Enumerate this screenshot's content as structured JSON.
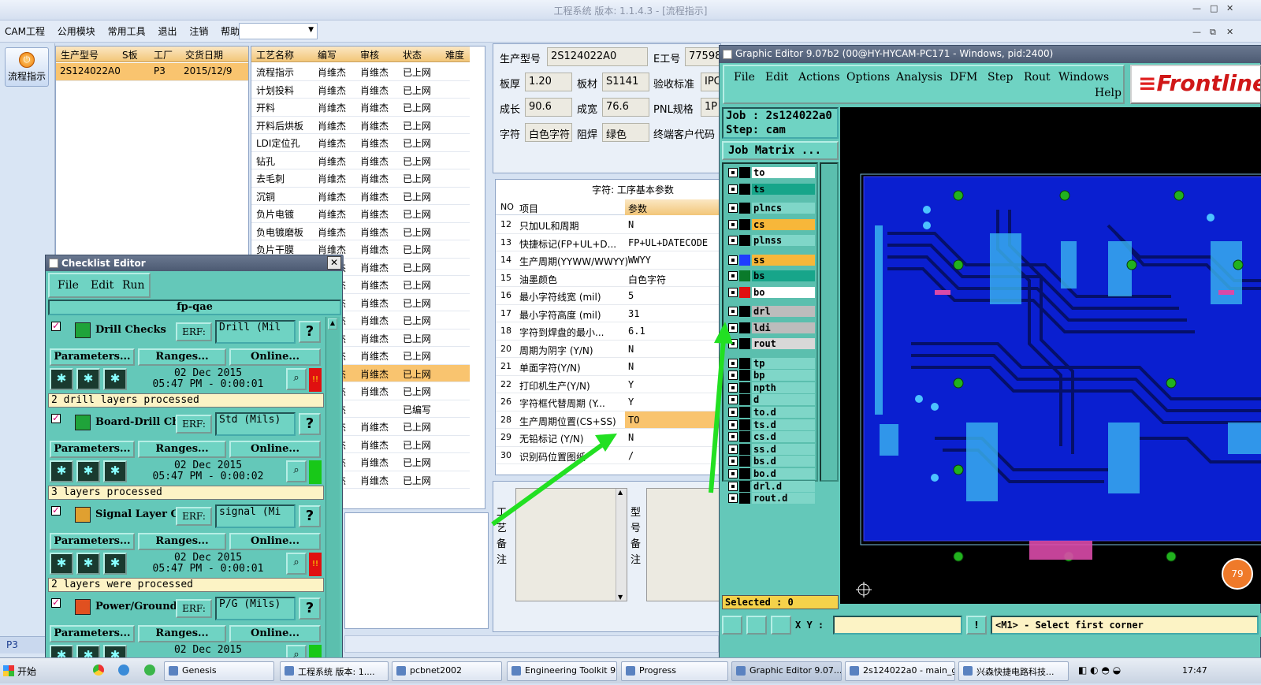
{
  "app": {
    "title": "工程系统  版本: 1.1.4.3 - [流程指示]",
    "menus": [
      "CAM工程",
      "公用模块",
      "常用工具",
      "退出",
      "注销",
      "帮助"
    ],
    "nav_button": "流程指示",
    "nav_bottom": "P3"
  },
  "order_grid": {
    "headers": [
      "生产型号",
      "S板",
      "工厂",
      "交货日期"
    ],
    "rows": [
      [
        "2S124022A0",
        "",
        "P3",
        "2015/12/9"
      ]
    ]
  },
  "process_grid": {
    "headers": [
      "工艺名称",
      "编写",
      "审核",
      "状态",
      "难度"
    ],
    "rows": [
      [
        "流程指示",
        "肖维杰",
        "肖维杰",
        "已上网",
        ""
      ],
      [
        "计划投料",
        "肖维杰",
        "肖维杰",
        "已上网",
        ""
      ],
      [
        "开料",
        "肖维杰",
        "肖维杰",
        "已上网",
        ""
      ],
      [
        "开料后烘板",
        "肖维杰",
        "肖维杰",
        "已上网",
        ""
      ],
      [
        "LDI定位孔",
        "肖维杰",
        "肖维杰",
        "已上网",
        ""
      ],
      [
        "钻孔",
        "肖维杰",
        "肖维杰",
        "已上网",
        ""
      ],
      [
        "去毛刺",
        "肖维杰",
        "肖维杰",
        "已上网",
        ""
      ],
      [
        "沉铜",
        "肖维杰",
        "肖维杰",
        "已上网",
        ""
      ],
      [
        "负片电镀",
        "肖维杰",
        "肖维杰",
        "已上网",
        ""
      ],
      [
        "负电镀磨板",
        "肖维杰",
        "肖维杰",
        "已上网",
        ""
      ],
      [
        "负片干膜",
        "肖维杰",
        "肖维杰",
        "已上网",
        ""
      ],
      [
        "",
        "肖维杰",
        "肖维杰",
        "已上网",
        ""
      ],
      [
        "",
        "肖维杰",
        "肖维杰",
        "已上网",
        ""
      ],
      [
        "",
        "肖维杰",
        "肖维杰",
        "已上网",
        ""
      ],
      [
        "",
        "肖维杰",
        "肖维杰",
        "已上网",
        ""
      ],
      [
        "",
        "肖维杰",
        "肖维杰",
        "已上网",
        ""
      ],
      [
        "",
        "肖维杰",
        "肖维杰",
        "已上网",
        ""
      ],
      [
        "",
        "肖维杰",
        "肖维杰",
        "已上网",
        ""
      ],
      [
        "",
        "肖维杰",
        "肖维杰",
        "已上网",
        ""
      ],
      [
        "",
        "肖维杰",
        "",
        "已编写",
        ""
      ],
      [
        "",
        "肖维杰",
        "肖维杰",
        "已上网",
        ""
      ],
      [
        "",
        "肖维杰",
        "肖维杰",
        "已上网",
        ""
      ],
      [
        "",
        "肖维杰",
        "肖维杰",
        "已上网",
        ""
      ],
      [
        "",
        "肖维杰",
        "肖维杰",
        "已上网",
        ""
      ]
    ]
  },
  "params_top": {
    "model_label": "生产型号",
    "model": "2S124022A0",
    "e_label": "E工号",
    "e_val": "77598",
    "thick_label": "板厚",
    "thick": "1.20",
    "mat_label": "板材",
    "mat": "S1141",
    "std_label": "验收标准",
    "std": "IPC",
    "len_label": "成长",
    "len": "90.6",
    "wid_label": "成宽",
    "wid": "76.6",
    "pnl_label": "PNL规格",
    "pnl": "1P",
    "char_label": "字符",
    "char": "白色字符",
    "mask_label": "阻焊",
    "mask": "绿色",
    "cust_label": "终端客户代码"
  },
  "param_grid": {
    "title": "字符: 工序基本参数",
    "headers": [
      "NO",
      "项目",
      "参数"
    ],
    "rows": [
      [
        "12",
        "只加UL和周期",
        "N"
      ],
      [
        "13",
        "快捷标记(FP+UL+D...",
        "FP+UL+DATECODE"
      ],
      [
        "14",
        "生产周期(YYWW/WWYY)",
        "WWYY"
      ],
      [
        "15",
        "油墨颜色",
        "白色字符"
      ],
      [
        "16",
        "最小字符线宽 (mil)",
        "5"
      ],
      [
        "17",
        "最小字符高度 (mil)",
        "31"
      ],
      [
        "18",
        "字符到焊盘的最小...",
        "6.1"
      ],
      [
        "20",
        "周期为阴字 (Y/N)",
        "N"
      ],
      [
        "21",
        "单面字符(Y/N)",
        "N"
      ],
      [
        "22",
        "打印机生产(Y/N)",
        "Y"
      ],
      [
        "26",
        "字符框代替周期 (Y...",
        "Y"
      ],
      [
        "28",
        "生产周期位置(CS+SS)",
        "TO"
      ],
      [
        "29",
        "无铅标记 (Y/N)",
        "N"
      ],
      [
        "30",
        "识别码位置图纸",
        "/"
      ]
    ]
  },
  "notes": {
    "process_label": "工艺备注",
    "model_label": "型号备注"
  },
  "graphic_editor": {
    "title": "Graphic Editor 9.07b2 (00@HY-HYCAM-PC171 - Windows, pid:2400)",
    "menus": [
      "File",
      "Edit",
      "Actions",
      "Options",
      "Analysis",
      "DFM",
      "Step",
      "Rout",
      "Windows",
      "Help"
    ],
    "logo": "Frontline",
    "job": "Job : 2s124022a0",
    "step": "Step: cam",
    "matrix": "Job Matrix ...",
    "layers": [
      {
        "name": "to",
        "color": "#ffffff",
        "swatch": "#000000"
      },
      {
        "name": "ts",
        "color": "#17a58a",
        "swatch": "#000000"
      },
      {
        "name": "plncs",
        "color": "#7fd6c8",
        "swatch": "#000000"
      },
      {
        "name": "cs",
        "color": "#f7b73a",
        "swatch": "#000000"
      },
      {
        "name": "plnss",
        "color": "#7fd6c8",
        "swatch": "#000000"
      },
      {
        "name": "ss",
        "color": "#f7b73a",
        "swatch": "#1f3cff"
      },
      {
        "name": "bs",
        "color": "#17a58a",
        "swatch": "#0a7a2a"
      },
      {
        "name": "bo",
        "color": "#ffffff",
        "swatch": "#e01010"
      },
      {
        "name": "drl",
        "color": "#bcbcbc",
        "swatch": "#000000"
      },
      {
        "name": "ldi",
        "color": "#bcbcbc",
        "swatch": "#000000"
      },
      {
        "name": "rout",
        "color": "#d8d8d8",
        "swatch": "#000000"
      },
      {
        "name": "tp",
        "color": "#7fd6c8",
        "swatch": "#000000"
      },
      {
        "name": "bp",
        "color": "#7fd6c8",
        "swatch": "#000000"
      },
      {
        "name": "npth",
        "color": "#7fd6c8",
        "swatch": "#000000"
      },
      {
        "name": "d",
        "color": "#7fd6c8",
        "swatch": "#000000"
      },
      {
        "name": "to.d",
        "color": "#7fd6c8",
        "swatch": "#000000"
      },
      {
        "name": "ts.d",
        "color": "#7fd6c8",
        "swatch": "#000000"
      },
      {
        "name": "cs.d",
        "color": "#7fd6c8",
        "swatch": "#000000"
      },
      {
        "name": "ss.d",
        "color": "#7fd6c8",
        "swatch": "#000000"
      },
      {
        "name": "bs.d",
        "color": "#7fd6c8",
        "swatch": "#000000"
      },
      {
        "name": "bo.d",
        "color": "#7fd6c8",
        "swatch": "#000000"
      },
      {
        "name": "drl.d",
        "color": "#7fd6c8",
        "swatch": "#000000"
      },
      {
        "name": "rout.d",
        "color": "#7fd6c8",
        "swatch": "#000000"
      }
    ],
    "selected": "Selected : 0",
    "xy_label": "X Y :",
    "prompt": "<M1> - Select first corner",
    "badge": "79"
  },
  "checklist": {
    "title": "Checklist Editor",
    "menus": [
      "File",
      "Edit",
      "Run"
    ],
    "name": "fp-qae",
    "erf_label": "ERF:",
    "params_btn": "Parameters...",
    "ranges_btn": "Ranges...",
    "online_btn": "Online...",
    "checks": [
      {
        "name": "Drill Checks",
        "erf": "Drill (Mil",
        "date": "02 Dec 2015",
        "time": "05:47 PM - 0:00:01",
        "msg": "2 drill layers processed",
        "status": "#e01010",
        "status_text": "!!",
        "icon": "#1fa33a"
      },
      {
        "name": "Board-Drill Che",
        "erf": "Std (Mils)",
        "date": "02 Dec 2015",
        "time": "05:47 PM - 0:00:02",
        "msg": "3 layers processed",
        "status": "#18c818",
        "status_text": "",
        "icon": "#1fa33a"
      },
      {
        "name": "Signal Layer Ch",
        "erf": "signal (Mi",
        "date": "02 Dec 2015",
        "time": "05:47 PM - 0:00:01",
        "msg": "2 layers were processed",
        "status": "#e01010",
        "status_text": "!!",
        "icon": "#e0a030"
      },
      {
        "name": "Power/Ground C",
        "erf": "P/G (Mils)",
        "date": "02 Dec 2015",
        "time": "",
        "msg": "",
        "status": "#18c818",
        "status_text": "",
        "icon": "#e05020"
      }
    ]
  },
  "taskbar": {
    "start": "开始",
    "items": [
      "Genesis",
      "工程系统  版本: 1....",
      "pcbnet2002",
      "Engineering Toolkit 9....",
      "Progress",
      "Graphic Editor 9.07...",
      "2s124022a0 - main_ga...",
      "兴森快捷电路科技..."
    ],
    "clock": "17:47"
  }
}
